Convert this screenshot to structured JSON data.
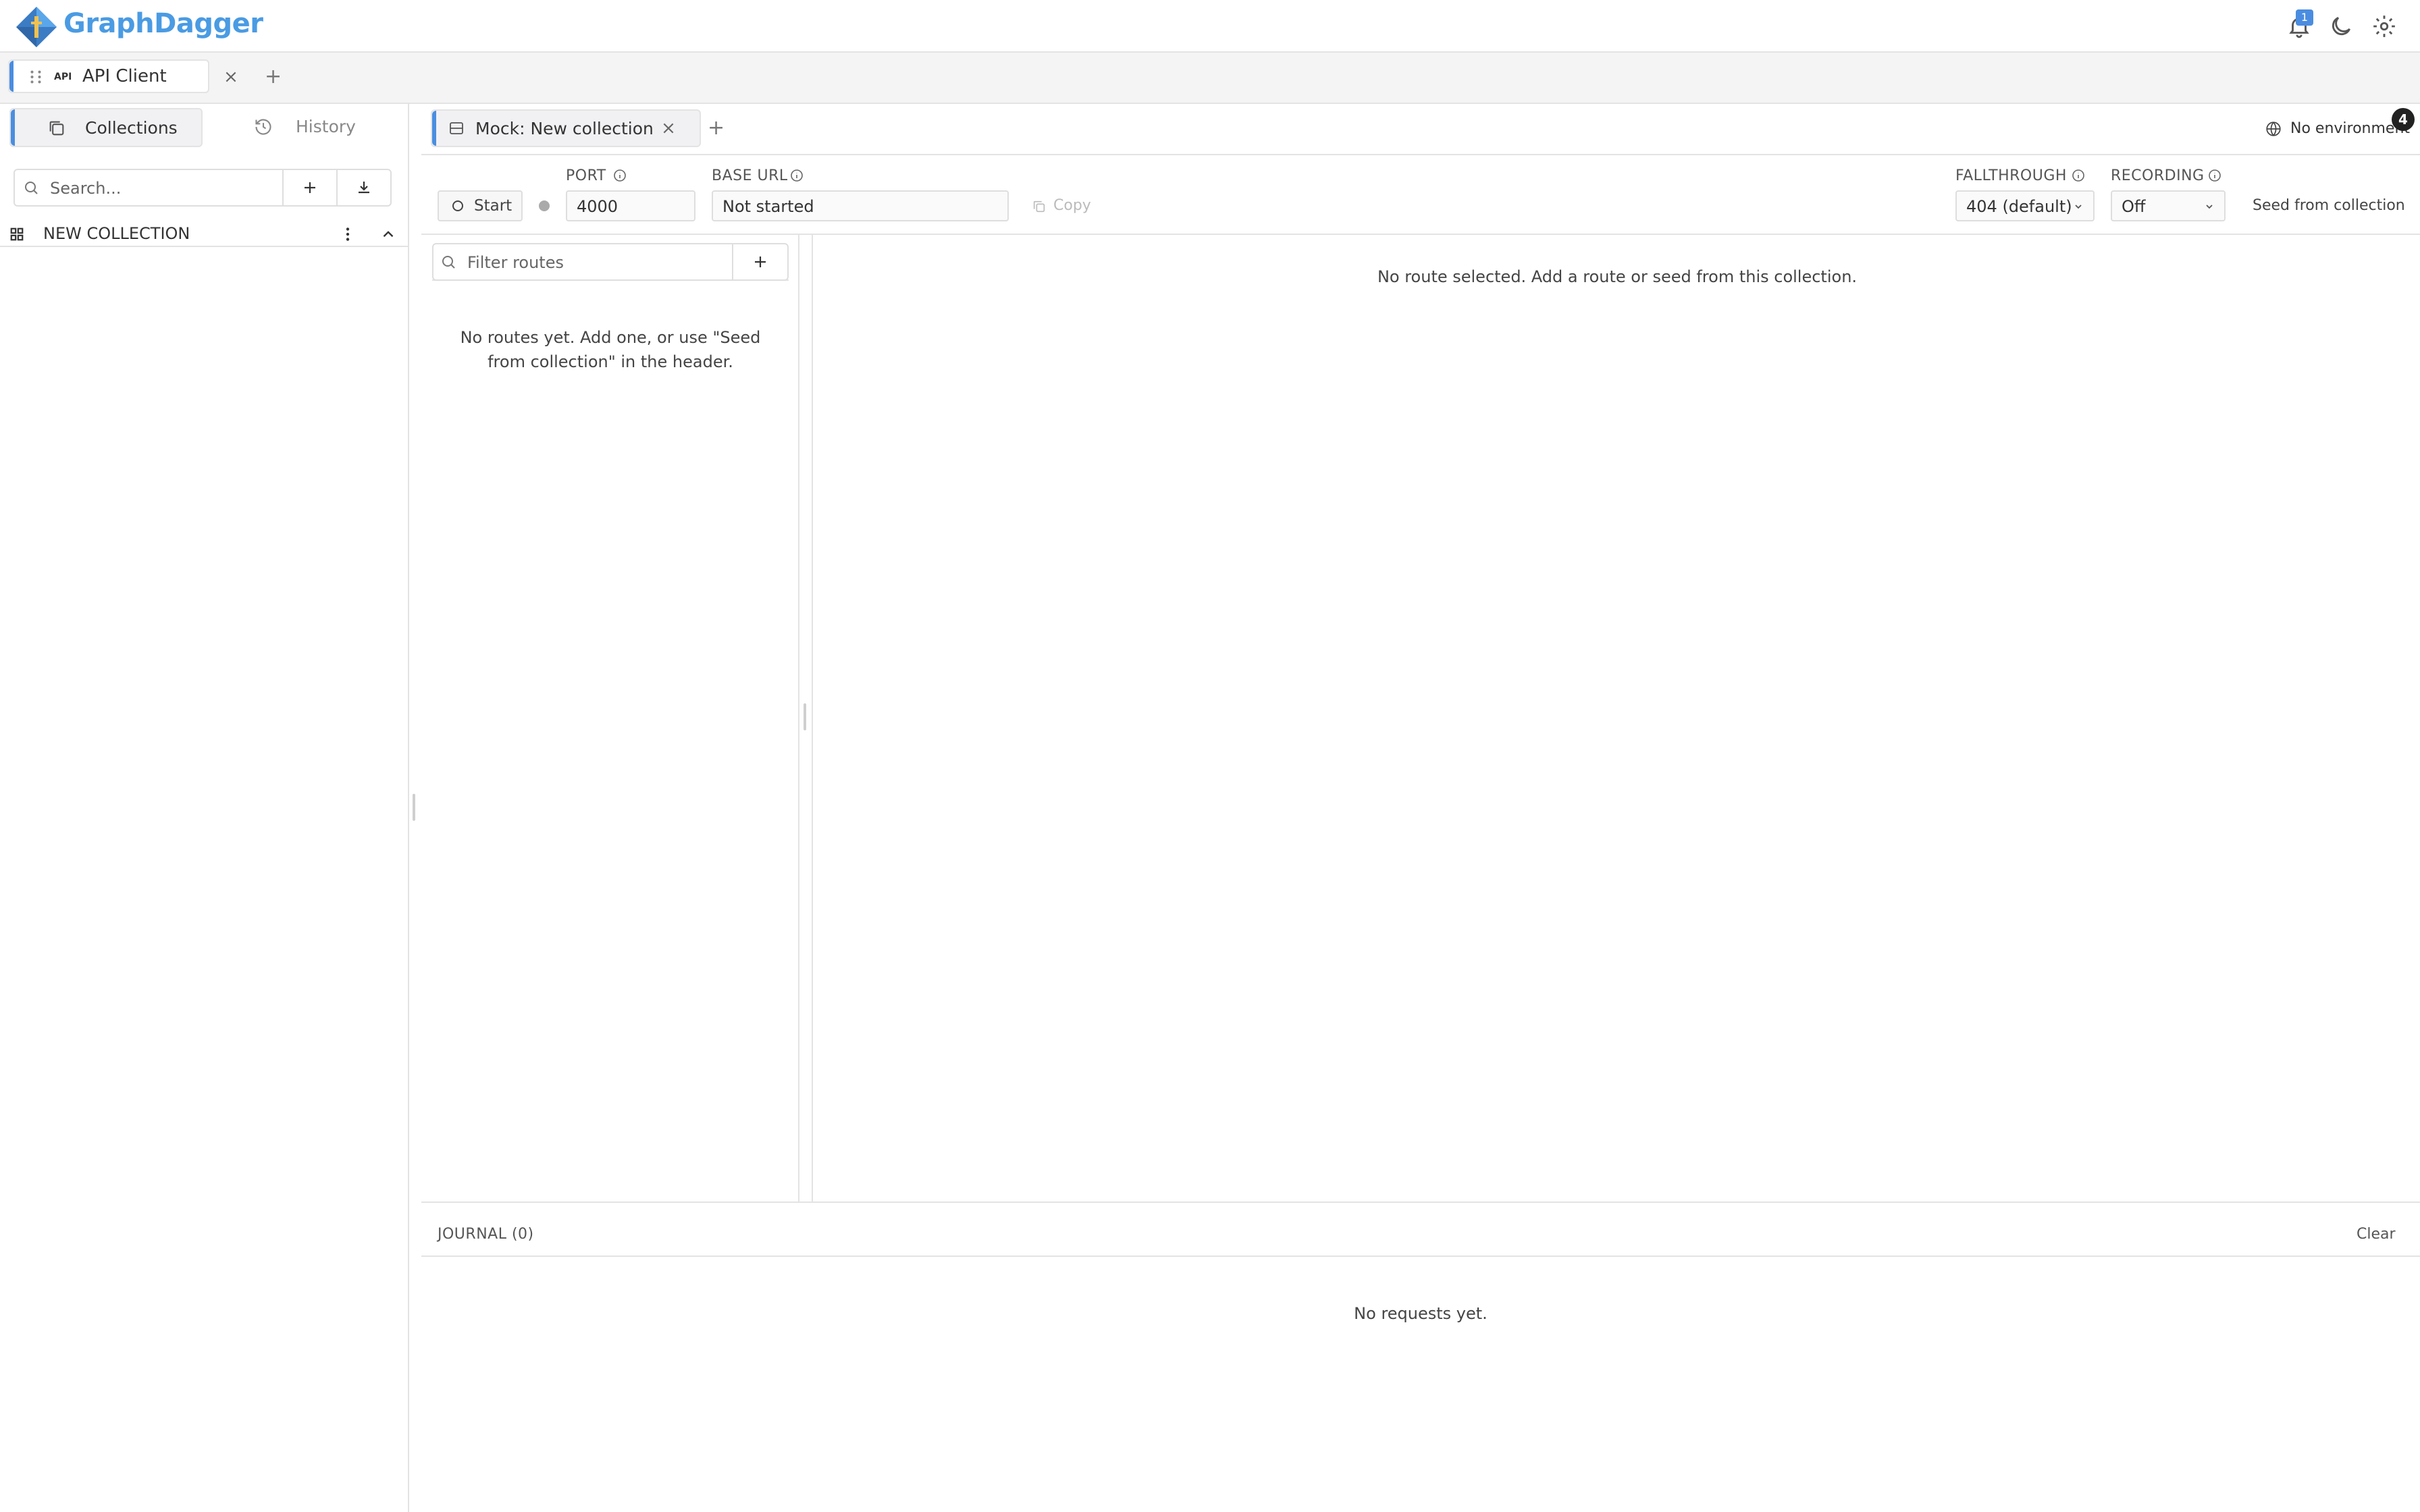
{
  "header": {
    "app_name": "GraphDagger",
    "notification_count": "1",
    "icons": [
      "bell-icon",
      "moon-icon",
      "gear-icon"
    ]
  },
  "tabbar": {
    "tab": {
      "badge": "API",
      "label": "API Client"
    },
    "add_label": "+"
  },
  "sidebar": {
    "tabs": [
      {
        "label": "Collections",
        "active": true
      },
      {
        "label": "History",
        "active": false
      }
    ],
    "search_placeholder": "Search...",
    "collection": {
      "name": "NEW COLLECTION"
    }
  },
  "panel": {
    "tab_label": "Mock: New collection",
    "add_label": "+",
    "environment": "No environment",
    "environment_badge": "4"
  },
  "server": {
    "start_label": "Start",
    "port_label": "PORT",
    "port_value": "4000",
    "base_url_label": "BASE URL",
    "base_url_value": "Not started",
    "copy_label": "Copy",
    "fallthrough_label": "FALLTHROUGH",
    "fallthrough_value": "404 (default)",
    "recording_label": "RECORDING",
    "recording_value": "Off",
    "seed_label": "Seed from collection"
  },
  "routes": {
    "filter_placeholder": "Filter routes",
    "empty_line1": "No routes yet. Add one, or use \"Seed",
    "empty_line2": "from collection\" in the header."
  },
  "detail": {
    "empty_message": "No route selected. Add a route or seed from this collection."
  },
  "journal": {
    "title": "JOURNAL (0)",
    "clear_label": "Clear",
    "empty_message": "No requests yet."
  },
  "colors": {
    "accent": "#4a8de0",
    "logo": "#4a9be3",
    "border": "#e3e3e3"
  }
}
